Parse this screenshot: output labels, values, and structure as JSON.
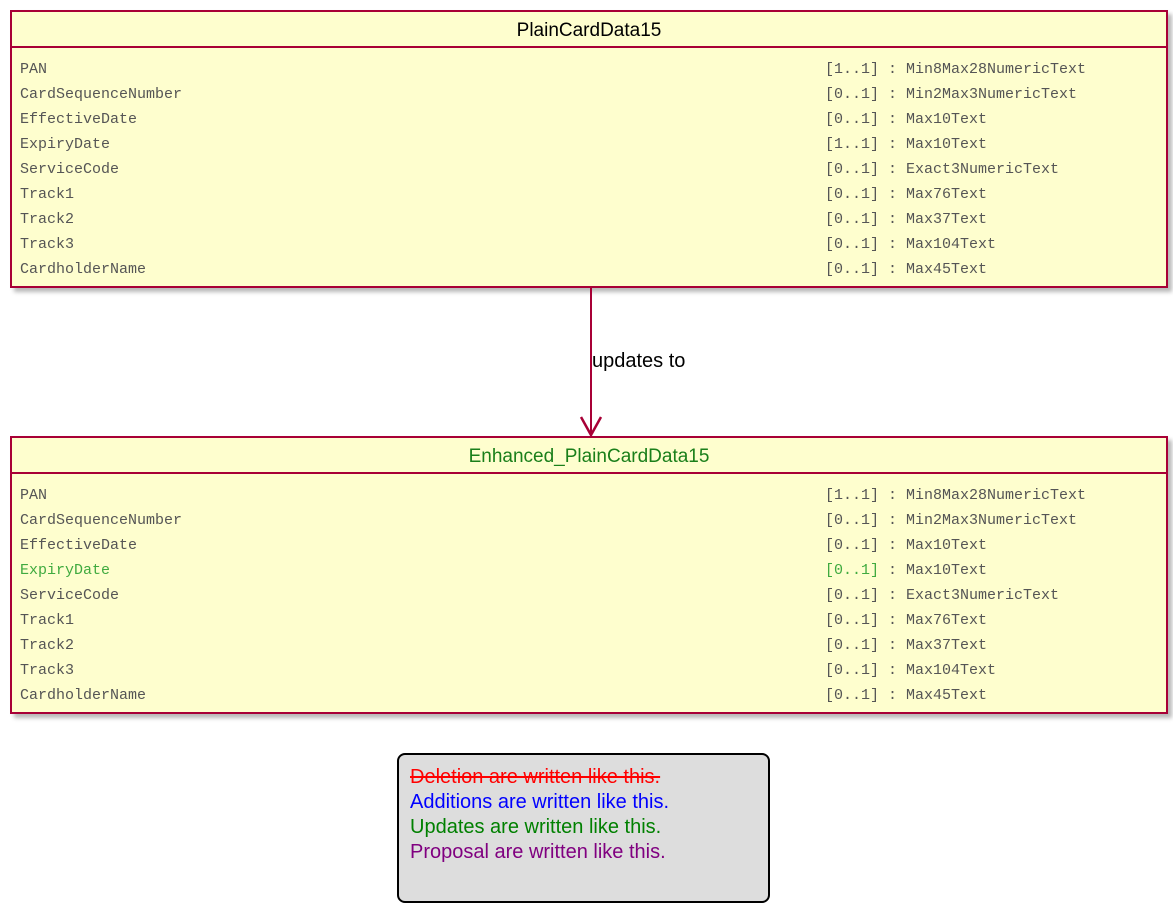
{
  "source_class": {
    "title": "PlainCardData15",
    "attributes": [
      {
        "name": "PAN",
        "multiplicity": "[1..1]",
        "type": "Min8Max28NumericText"
      },
      {
        "name": "CardSequenceNumber",
        "multiplicity": "[0..1]",
        "type": "Min2Max3NumericText"
      },
      {
        "name": "EffectiveDate",
        "multiplicity": "[0..1]",
        "type": "Max10Text"
      },
      {
        "name": "ExpiryDate",
        "multiplicity": "[1..1]",
        "type": "Max10Text"
      },
      {
        "name": "ServiceCode",
        "multiplicity": "[0..1]",
        "type": "Exact3NumericText"
      },
      {
        "name": "Track1",
        "multiplicity": "[0..1]",
        "type": "Max76Text"
      },
      {
        "name": "Track2",
        "multiplicity": "[0..1]",
        "type": "Max37Text"
      },
      {
        "name": "Track3",
        "multiplicity": "[0..1]",
        "type": "Max104Text"
      },
      {
        "name": "CardholderName",
        "multiplicity": "[0..1]",
        "type": "Max45Text"
      }
    ]
  },
  "edge": {
    "label": "updates to"
  },
  "target_class": {
    "title": "Enhanced_PlainCardData15",
    "attributes": [
      {
        "name": "PAN",
        "multiplicity": "[1..1]",
        "type": "Min8Max28NumericText"
      },
      {
        "name": "CardSequenceNumber",
        "multiplicity": "[0..1]",
        "type": "Min2Max3NumericText"
      },
      {
        "name": "EffectiveDate",
        "multiplicity": "[0..1]",
        "type": "Max10Text"
      },
      {
        "name": "ExpiryDate",
        "multiplicity": "[0..1]",
        "type": "Max10Text",
        "status": "updated"
      },
      {
        "name": "ServiceCode",
        "multiplicity": "[0..1]",
        "type": "Exact3NumericText"
      },
      {
        "name": "Track1",
        "multiplicity": "[0..1]",
        "type": "Max76Text"
      },
      {
        "name": "Track2",
        "multiplicity": "[0..1]",
        "type": "Max37Text"
      },
      {
        "name": "Track3",
        "multiplicity": "[0..1]",
        "type": "Max104Text"
      },
      {
        "name": "CardholderName",
        "multiplicity": "[0..1]",
        "type": "Max45Text"
      }
    ]
  },
  "legend": {
    "deletion": "Deletion are written like this.",
    "addition": "Additions are written like this.",
    "update": "Updates are written like this.",
    "proposal": "Proposal are written like this."
  },
  "colors": {
    "class_fill": "#fefece",
    "class_border": "#a80036",
    "updated": "#3faa3f",
    "deletion": "#ff0000",
    "addition": "#0000ff",
    "update": "#008000",
    "proposal": "#800080",
    "legend_fill": "#dddddd"
  }
}
